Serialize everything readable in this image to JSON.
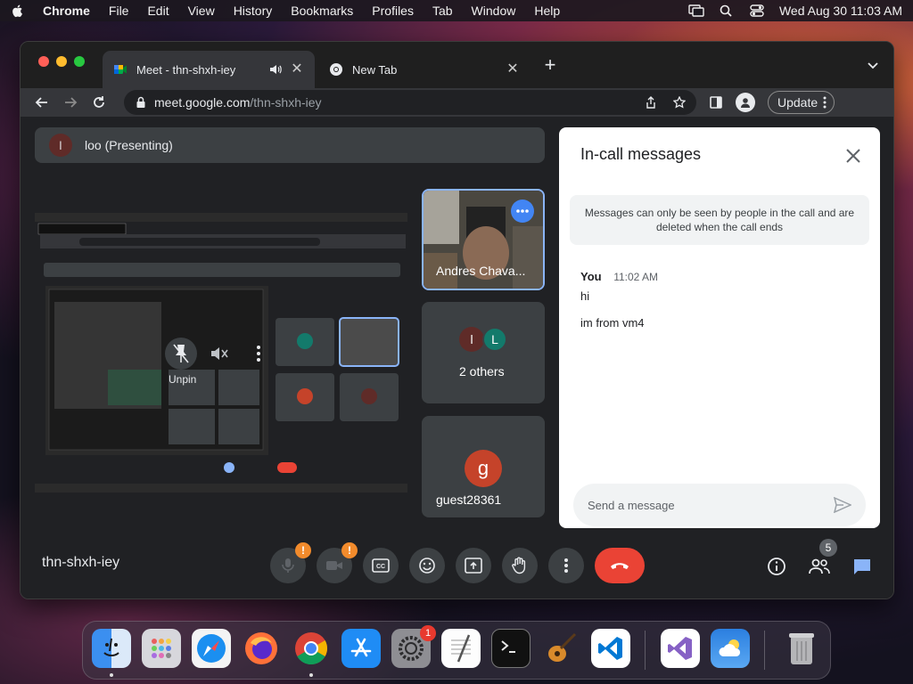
{
  "menubar": {
    "app_name": "Chrome",
    "menus": [
      "File",
      "Edit",
      "View",
      "History",
      "Bookmarks",
      "Profiles",
      "Tab",
      "Window",
      "Help"
    ],
    "clock": "Wed Aug 30  11:03 AM"
  },
  "browser": {
    "tabs": [
      {
        "title": "Meet - thn-shxh-iey",
        "active": true,
        "icon": "google-meet-icon",
        "audio": true
      },
      {
        "title": "New Tab",
        "active": false,
        "icon": "chrome-icon",
        "audio": false
      }
    ],
    "url_host": "meet.google.com",
    "url_path": "/thn-shxh-iey",
    "update_label": "Update"
  },
  "meet": {
    "presenter_initial": "l",
    "presenter_label": "loo (Presenting)",
    "unpin_label": "Unpin",
    "tiles": [
      {
        "name": "Andres Chava...",
        "type": "video"
      },
      {
        "name": "2 others",
        "initials": [
          "l",
          "L"
        ],
        "type": "group"
      },
      {
        "name": "guest28361",
        "initial": "g",
        "type": "avatar",
        "color": "#c5432a"
      }
    ],
    "meeting_code": "thn-shxh-iey",
    "participant_count": "5",
    "warning_mark": "!",
    "chat": {
      "title": "In-call messages",
      "notice": "Messages can only be seen by people in the call and are deleted when the call ends",
      "sender": "You",
      "time": "11:02 AM",
      "messages": [
        "hi",
        "im from vm4"
      ],
      "input_placeholder": "Send a message"
    }
  },
  "dock": {
    "apps": [
      "Finder",
      "Launchpad",
      "Safari",
      "Firefox",
      "Google Chrome",
      "App Store",
      "System Settings",
      "TextEdit",
      "Terminal",
      "GarageBand",
      "Visual Studio Code",
      "Visual Studio",
      "Weather",
      "Trash"
    ],
    "settings_badge": "1"
  },
  "colors": {
    "meet_bg": "#202124",
    "tile_bg": "#3c4043",
    "end_call": "#ea4335",
    "warning": "#f28b2c",
    "chat_accent": "#8ab4f8"
  }
}
